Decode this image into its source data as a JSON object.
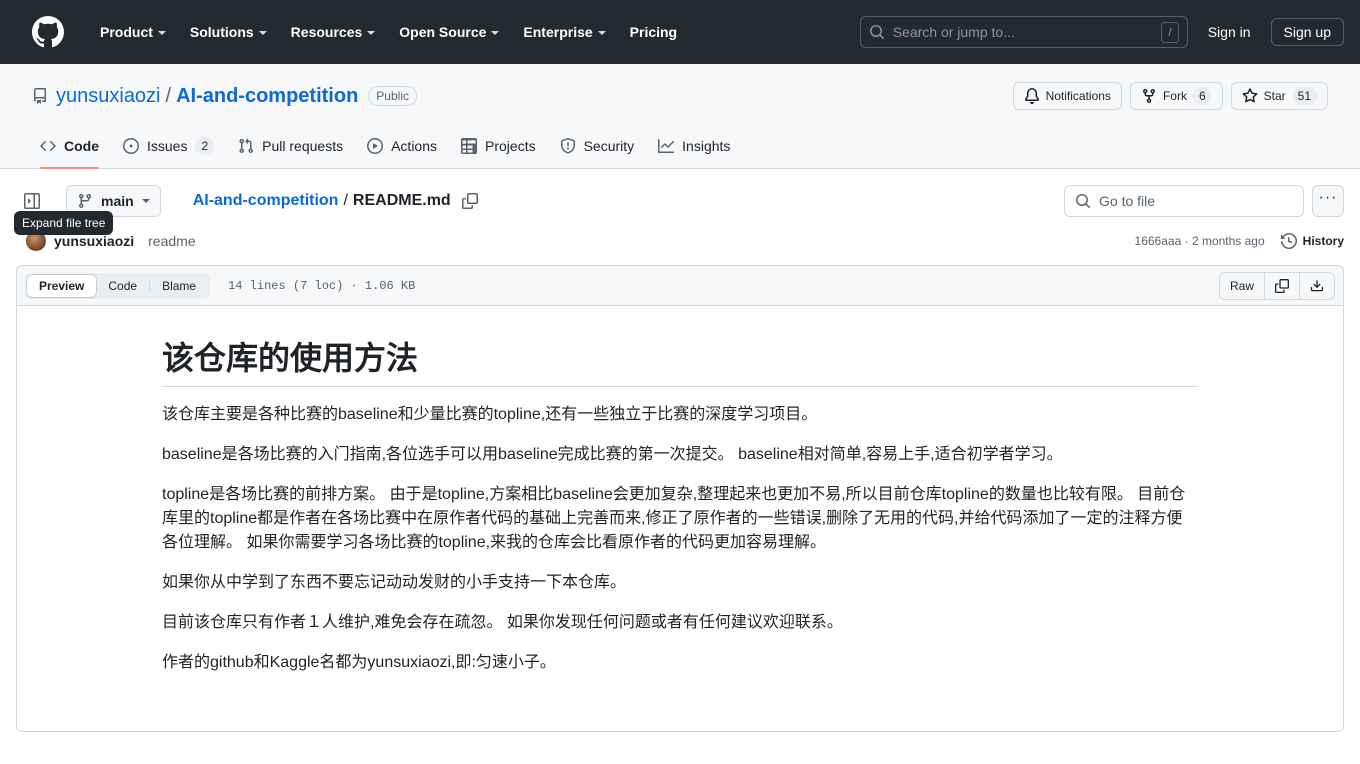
{
  "header": {
    "logo_icon": "github-mark-icon",
    "nav": [
      {
        "label": "Product",
        "has_caret": true
      },
      {
        "label": "Solutions",
        "has_caret": true
      },
      {
        "label": "Resources",
        "has_caret": true
      },
      {
        "label": "Open Source",
        "has_caret": true
      },
      {
        "label": "Enterprise",
        "has_caret": true
      },
      {
        "label": "Pricing",
        "has_caret": false
      }
    ],
    "search": {
      "placeholder": "Search or jump to...",
      "shortcut": "/",
      "icon": "search-icon"
    },
    "sign_in": "Sign in",
    "sign_up": "Sign up"
  },
  "repo": {
    "icon": "repo-icon",
    "owner": "yunsuxiaozi",
    "separator": "/",
    "name": "AI-and-competition",
    "visibility": "Public",
    "actions": {
      "notifications_label": "Notifications",
      "notifications_icon": "bell-icon",
      "fork_label": "Fork",
      "fork_icon": "fork-icon",
      "fork_count": "6",
      "star_label": "Star",
      "star_icon": "star-icon",
      "star_count": "51"
    },
    "tabs": [
      {
        "label": "Code",
        "icon": "code-icon",
        "selected": true,
        "count": ""
      },
      {
        "label": "Issues",
        "icon": "issue-opened-icon",
        "selected": false,
        "count": "2"
      },
      {
        "label": "Pull requests",
        "icon": "git-pull-request-icon",
        "selected": false,
        "count": ""
      },
      {
        "label": "Actions",
        "icon": "play-icon",
        "selected": false,
        "count": ""
      },
      {
        "label": "Projects",
        "icon": "table-icon",
        "selected": false,
        "count": ""
      },
      {
        "label": "Security",
        "icon": "shield-icon",
        "selected": false,
        "count": ""
      },
      {
        "label": "Insights",
        "icon": "graph-icon",
        "selected": false,
        "count": ""
      }
    ]
  },
  "file_nav": {
    "sidebar_toggle_icon": "sidebar-expand-icon",
    "tooltip": "Expand file tree",
    "branch": "main",
    "branch_icon": "git-branch-icon",
    "breadcrumb_repo": "AI-and-competition",
    "breadcrumb_sep": "/",
    "breadcrumb_file": "README.md",
    "copy_path_icon": "copy-icon",
    "goto_file_placeholder": "Go to file",
    "goto_file_icon": "search-icon",
    "kebab_label": "···"
  },
  "commit": {
    "avatar": "avatar",
    "author": "yunsuxiaozi",
    "message": "readme",
    "sha": "1666aaa",
    "separator": "·",
    "time": "2 months ago",
    "history_label": "History",
    "history_icon": "history-icon"
  },
  "file_box": {
    "tabs": [
      {
        "label": "Preview",
        "active": true
      },
      {
        "label": "Code",
        "active": false
      },
      {
        "label": "Blame",
        "active": false
      }
    ],
    "meta": "14 lines (7 loc) · 1.06 KB",
    "raw_label": "Raw",
    "copy_icon": "copy-icon",
    "download_icon": "download-icon"
  },
  "readme": {
    "title": "该仓库的使用方法",
    "paragraphs": [
      "该仓库主要是各种比赛的baseline和少量比赛的topline,还有一些独立于比赛的深度学习项目。",
      "baseline是各场比赛的入门指南,各位选手可以用baseline完成比赛的第一次提交。 baseline相对简单,容易上手,适合初学者学习。",
      "topline是各场比赛的前排方案。 由于是topline,方案相比baseline会更加复杂,整理起来也更加不易,所以目前仓库topline的数量也比较有限。 目前仓库里的topline都是作者在各场比赛中在原作者代码的基础上完善而来,修正了原作者的一些错误,删除了无用的代码,并给代码添加了一定的注释方便各位理解。 如果你需要学习各场比赛的topline,来我的仓库会比看原作者的代码更加容易理解。",
      "如果你从中学到了东西不要忘记动动发财的小手支持一下本仓库。",
      "目前该仓库只有作者１人维护,难免会存在疏忽。 如果你发现任何问题或者有任何建议欢迎联系。",
      "作者的github和Kaggle名都为yunsuxiaozi,即:匀速小子。"
    ]
  },
  "colors": {
    "header_bg": "#24292f",
    "link": "#0969da",
    "accent_underline": "#fd8c73",
    "border": "#d1d9e0",
    "muted": "#59636e",
    "subtle_bg": "#f6f8fa"
  }
}
